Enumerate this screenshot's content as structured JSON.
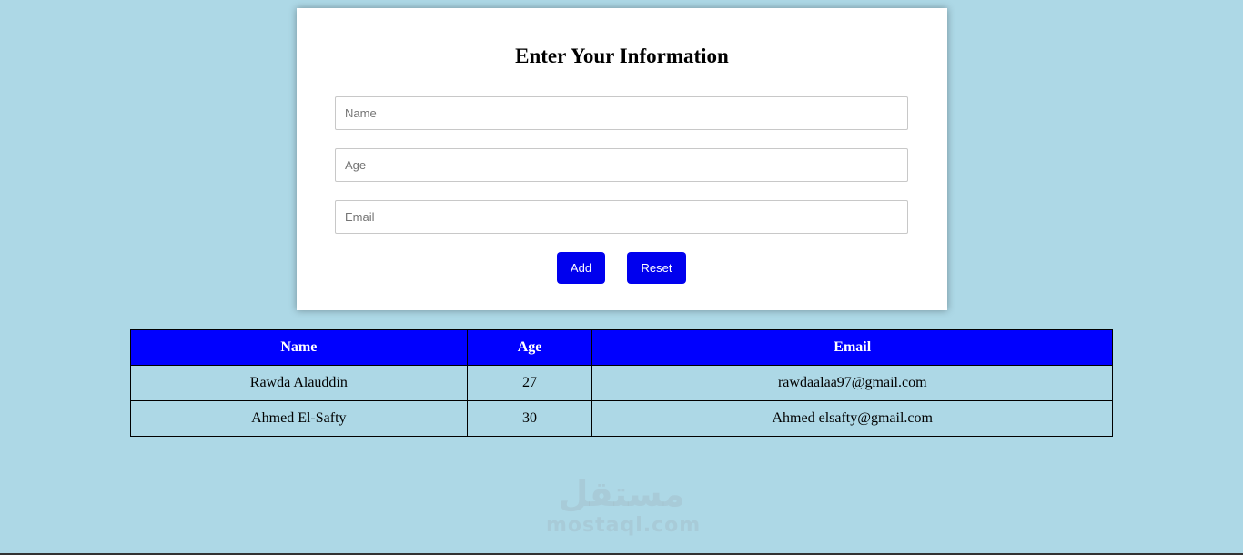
{
  "form": {
    "title": "Enter Your Information",
    "fields": {
      "name": {
        "placeholder": "Name",
        "value": ""
      },
      "age": {
        "placeholder": "Age",
        "value": ""
      },
      "email": {
        "placeholder": "Email",
        "value": ""
      }
    },
    "buttons": {
      "add": "Add",
      "reset": "Reset"
    }
  },
  "table": {
    "headers": [
      "Name",
      "Age",
      "Email"
    ],
    "rows": [
      [
        "Rawda Alauddin",
        "27",
        "rawdaalaa97@gmail.com"
      ],
      [
        "Ahmed El-Safty",
        "30",
        "Ahmed elsafty@gmail.com"
      ]
    ]
  },
  "watermark": {
    "arabic": "مستقل",
    "latin": "mostaql.com"
  },
  "colors": {
    "background": "#add8e6",
    "accent": "#0000ff"
  }
}
